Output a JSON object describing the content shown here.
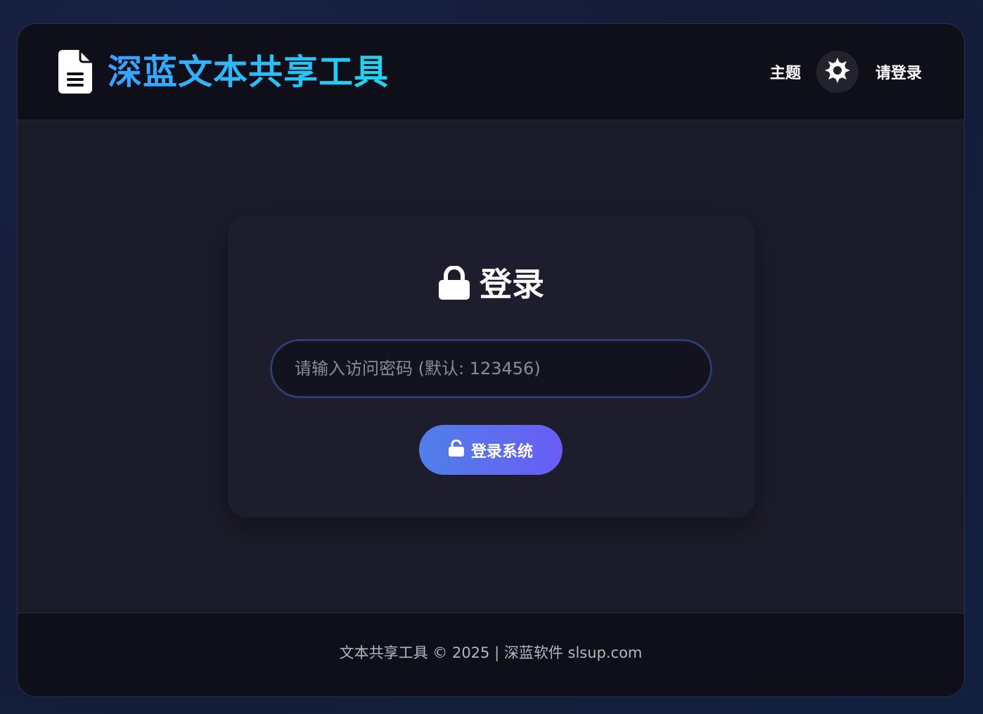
{
  "header": {
    "app_title": "深蓝文本共享工具",
    "logo_icon": "file-text-icon",
    "theme_label": "主题",
    "theme_icon": "gear-icon",
    "login_link": "请登录"
  },
  "login_card": {
    "lock_icon": "lock-icon",
    "title": "登录",
    "password_placeholder": "请输入访问密码 (默认: 123456)",
    "password_value": "",
    "button_icon": "unlock-icon",
    "button_label": "登录系统"
  },
  "footer": {
    "text": "文本共享工具 © 2025 | 深蓝软件 slsup.com"
  },
  "colors": {
    "title_gradient_start": "#3aa0ff",
    "title_gradient_end": "#21d4f0",
    "button_gradient_start": "#4f80e8",
    "button_gradient_end": "#6a5cf6",
    "input_border": "#2d3d6e"
  }
}
